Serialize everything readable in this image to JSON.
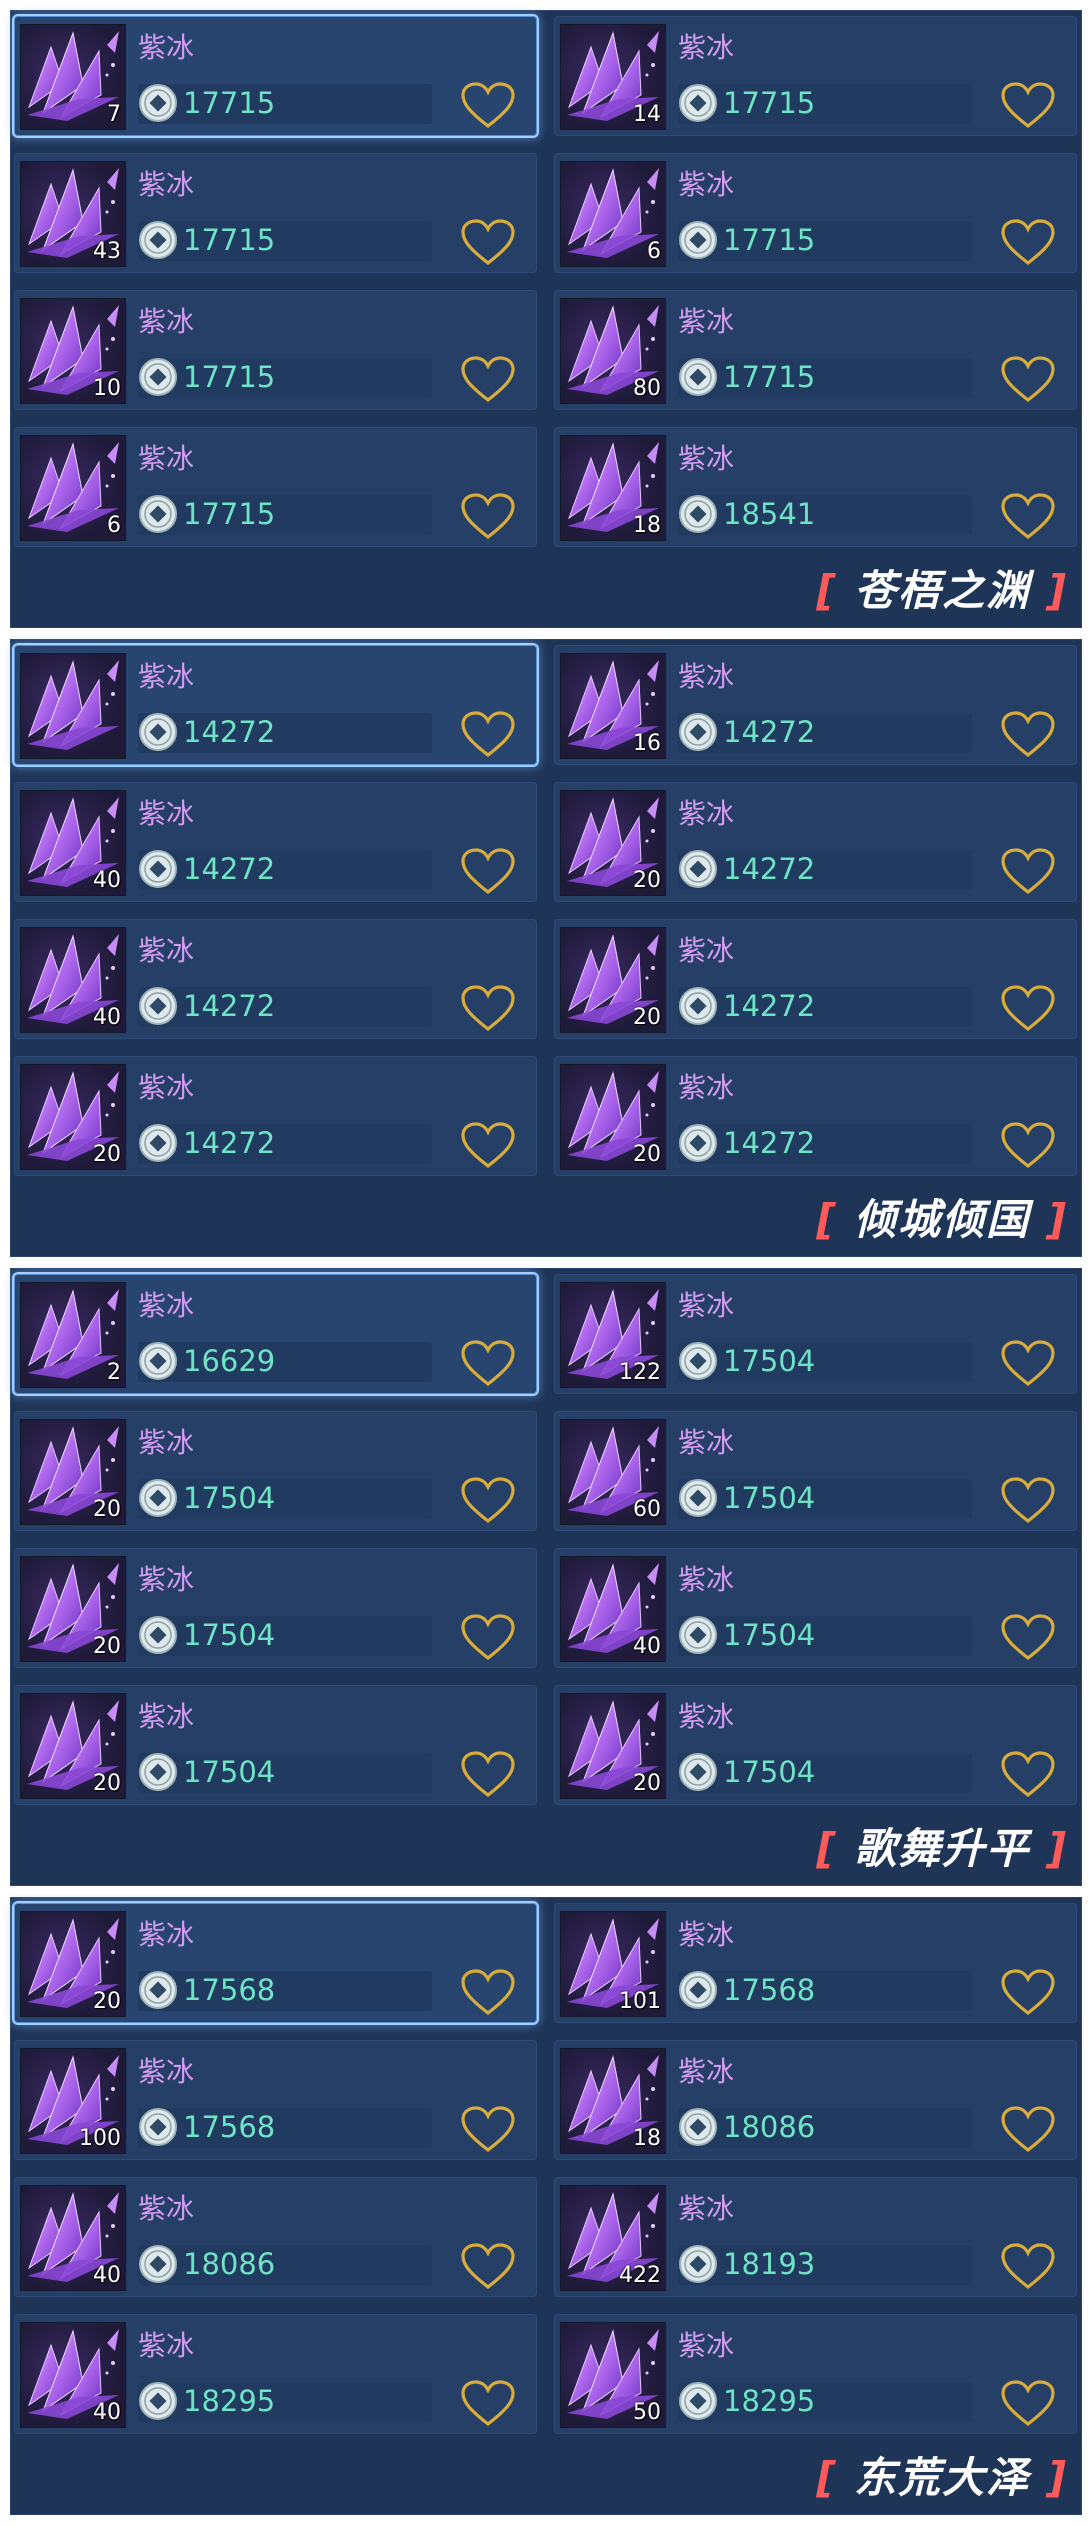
{
  "colors": {
    "panel_bg": "#1f3558",
    "slot_bg": "#263f66",
    "item_name": "#d59bf0",
    "price": "#6fe3c5",
    "heart_outline": "#d8ad3c",
    "server_bracket": "#ff5a5a",
    "server_text": "#ffffff"
  },
  "icons": {
    "item": "purple-crystal-icon",
    "currency": "silver-coin-icon",
    "favorite": "heart-outline-icon"
  },
  "sections": [
    {
      "server": {
        "open": "[",
        "name": "苍梧之渊",
        "close": "]"
      },
      "items": [
        {
          "name": "紫冰",
          "qty": "7",
          "price": "17715",
          "selected": true
        },
        {
          "name": "紫冰",
          "qty": "14",
          "price": "17715",
          "selected": false
        },
        {
          "name": "紫冰",
          "qty": "43",
          "price": "17715",
          "selected": false
        },
        {
          "name": "紫冰",
          "qty": "6",
          "price": "17715",
          "selected": false
        },
        {
          "name": "紫冰",
          "qty": "10",
          "price": "17715",
          "selected": false
        },
        {
          "name": "紫冰",
          "qty": "80",
          "price": "17715",
          "selected": false
        },
        {
          "name": "紫冰",
          "qty": "6",
          "price": "17715",
          "selected": false
        },
        {
          "name": "紫冰",
          "qty": "18",
          "price": "18541",
          "selected": false
        }
      ]
    },
    {
      "server": {
        "open": "[",
        "name": "倾城倾国",
        "close": "]"
      },
      "items": [
        {
          "name": "紫冰",
          "qty": "",
          "price": "14272",
          "selected": true
        },
        {
          "name": "紫冰",
          "qty": "16",
          "price": "14272",
          "selected": false
        },
        {
          "name": "紫冰",
          "qty": "40",
          "price": "14272",
          "selected": false
        },
        {
          "name": "紫冰",
          "qty": "20",
          "price": "14272",
          "selected": false
        },
        {
          "name": "紫冰",
          "qty": "40",
          "price": "14272",
          "selected": false
        },
        {
          "name": "紫冰",
          "qty": "20",
          "price": "14272",
          "selected": false
        },
        {
          "name": "紫冰",
          "qty": "20",
          "price": "14272",
          "selected": false
        },
        {
          "name": "紫冰",
          "qty": "20",
          "price": "14272",
          "selected": false
        }
      ]
    },
    {
      "server": {
        "open": "[",
        "name": "歌舞升平",
        "close": "]"
      },
      "items": [
        {
          "name": "紫冰",
          "qty": "2",
          "price": "16629",
          "selected": true
        },
        {
          "name": "紫冰",
          "qty": "122",
          "price": "17504",
          "selected": false
        },
        {
          "name": "紫冰",
          "qty": "20",
          "price": "17504",
          "selected": false
        },
        {
          "name": "紫冰",
          "qty": "60",
          "price": "17504",
          "selected": false
        },
        {
          "name": "紫冰",
          "qty": "20",
          "price": "17504",
          "selected": false
        },
        {
          "name": "紫冰",
          "qty": "40",
          "price": "17504",
          "selected": false
        },
        {
          "name": "紫冰",
          "qty": "20",
          "price": "17504",
          "selected": false
        },
        {
          "name": "紫冰",
          "qty": "20",
          "price": "17504",
          "selected": false
        }
      ]
    },
    {
      "server": {
        "open": "[",
        "name": "东荒大泽",
        "close": "]"
      },
      "items": [
        {
          "name": "紫冰",
          "qty": "20",
          "price": "17568",
          "selected": true
        },
        {
          "name": "紫冰",
          "qty": "101",
          "price": "17568",
          "selected": false
        },
        {
          "name": "紫冰",
          "qty": "100",
          "price": "17568",
          "selected": false
        },
        {
          "name": "紫冰",
          "qty": "18",
          "price": "18086",
          "selected": false
        },
        {
          "name": "紫冰",
          "qty": "40",
          "price": "18086",
          "selected": false
        },
        {
          "name": "紫冰",
          "qty": "422",
          "price": "18193",
          "selected": false
        },
        {
          "name": "紫冰",
          "qty": "40",
          "price": "18295",
          "selected": false
        },
        {
          "name": "紫冰",
          "qty": "50",
          "price": "18295",
          "selected": false
        }
      ]
    }
  ]
}
